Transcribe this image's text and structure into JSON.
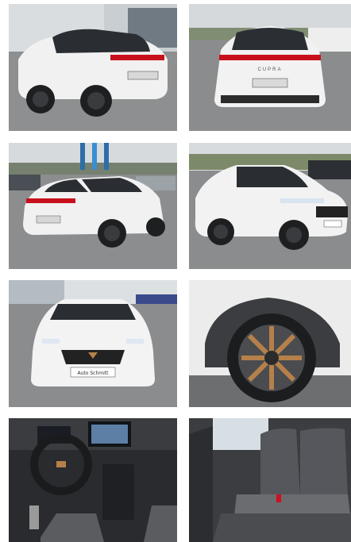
{
  "gallery": {
    "photos": [
      {
        "name": "rear-three-quarter-left",
        "caption": ""
      },
      {
        "name": "rear-straight",
        "caption": ""
      },
      {
        "name": "rear-three-quarter-right",
        "caption": ""
      },
      {
        "name": "front-three-quarter-right",
        "caption": ""
      },
      {
        "name": "front-straight",
        "caption": ""
      },
      {
        "name": "wheel-closeup",
        "caption": ""
      },
      {
        "name": "dashboard-interior",
        "caption": ""
      },
      {
        "name": "rear-seats-interior",
        "caption": ""
      }
    ]
  },
  "car": {
    "badge_text": "CUPRA",
    "color": "#f2f2f2",
    "accent_light": "#d01020",
    "copper": "#b5804a"
  },
  "dealer_plate": {
    "text": "Auto Schmitt"
  }
}
